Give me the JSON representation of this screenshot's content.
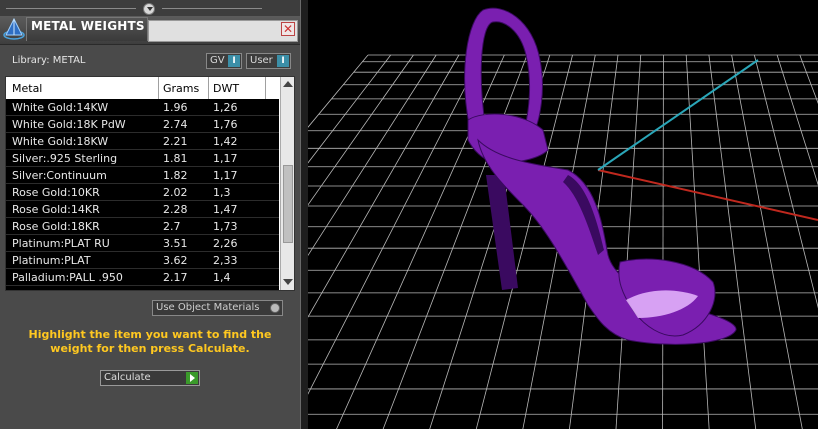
{
  "panel": {
    "title": "METAL WEIGHTS",
    "close_glyph": "✕",
    "library_label": "Library: METAL",
    "toggles": [
      {
        "label": "GV",
        "state": "I"
      },
      {
        "label": "User",
        "state": "I"
      }
    ],
    "table": {
      "headers": [
        "Metal",
        "Grams",
        "DWT"
      ],
      "rows": [
        {
          "metal": "White Gold:14KW",
          "grams": "1.96",
          "dwt": "1,26"
        },
        {
          "metal": "White Gold:18K PdW",
          "grams": "2.74",
          "dwt": "1,76"
        },
        {
          "metal": "White Gold:18KW",
          "grams": "2.21",
          "dwt": "1,42"
        },
        {
          "metal": "Silver:.925 Sterling",
          "grams": "1.81",
          "dwt": "1,17"
        },
        {
          "metal": "Silver:Continuum",
          "grams": "1.82",
          "dwt": "1,17"
        },
        {
          "metal": "Rose Gold:10KR",
          "grams": "2.02",
          "dwt": "1,3"
        },
        {
          "metal": "Rose Gold:14KR",
          "grams": "2.28",
          "dwt": "1,47"
        },
        {
          "metal": "Rose Gold:18KR",
          "grams": "2.7",
          "dwt": "1,73"
        },
        {
          "metal": "Platinum:PLAT RU",
          "grams": "3.51",
          "dwt": "2,26"
        },
        {
          "metal": "Platinum:PLAT",
          "grams": "3.62",
          "dwt": "2,33"
        },
        {
          "metal": "Palladium:PALL .950",
          "grams": "2.17",
          "dwt": "1,4"
        }
      ]
    },
    "use_object_materials_label": "Use Object Materials",
    "instruction": "Highlight the item you want to find the weight for then press Calculate.",
    "calculate_label": "Calculate"
  },
  "viewport": {
    "background": "#000000",
    "grid_color": "#b8b8b8",
    "axis_x_color": "#c0281e",
    "axis_y_color": "#2aa6b8",
    "model_color": "#7a1fb0",
    "model_highlight_color": "#e8b8ff",
    "model_shadow_color": "#3a0a60"
  }
}
